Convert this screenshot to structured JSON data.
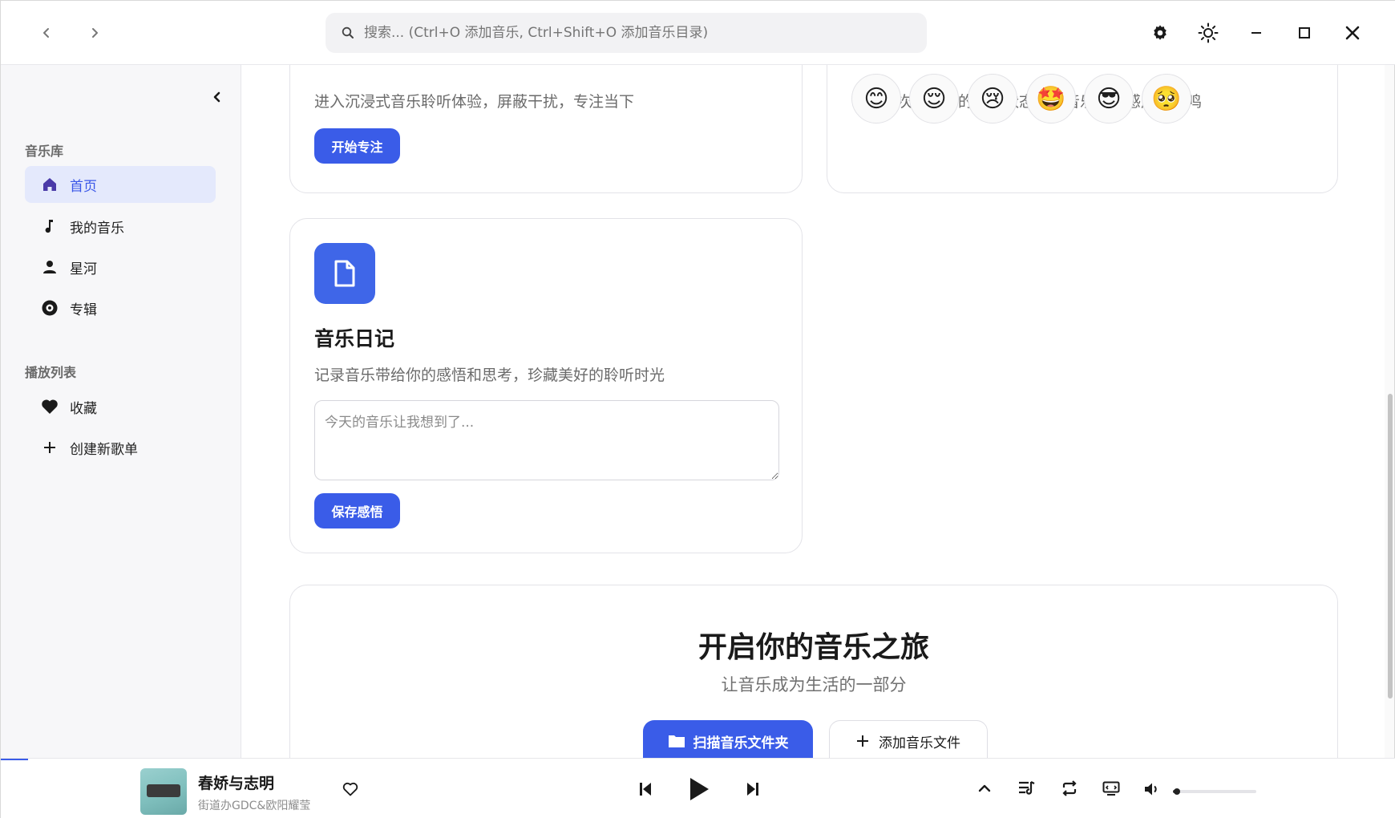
{
  "titlebar": {
    "search_placeholder": "搜索... (Ctrl+O 添加音乐, Ctrl+Shift+O 添加音乐目录)"
  },
  "sidebar": {
    "library_title": "音乐库",
    "library_items": [
      {
        "label": "首页",
        "icon": "home-icon",
        "active": true
      },
      {
        "label": "我的音乐",
        "icon": "music-note-icon",
        "active": false
      },
      {
        "label": "星河",
        "icon": "user-icon",
        "active": false
      },
      {
        "label": "专辑",
        "icon": "disc-icon",
        "active": false
      }
    ],
    "playlist_title": "播放列表",
    "playlist_items": [
      {
        "label": "收藏",
        "icon": "heart-icon"
      },
      {
        "label": "创建新歌单",
        "icon": "plus-icon"
      }
    ]
  },
  "main": {
    "focus_card": {
      "desc": "进入沉浸式音乐聆听体验，屏蔽干扰，专注当下",
      "button": "开始专注"
    },
    "mood_card": {
      "desc": "记录每次聆听时的心情状态，让音乐与情感产生共鸣",
      "emojis": [
        "😊",
        "😌",
        "😢",
        "🤩",
        "😎",
        "🥺"
      ]
    },
    "diary_card": {
      "title": "音乐日记",
      "desc": "记录音乐带给你的感悟和思考，珍藏美好的聆听时光",
      "placeholder": "今天的音乐让我想到了...",
      "button": "保存感悟"
    },
    "journey_card": {
      "title": "开启你的音乐之旅",
      "subtitle": "让音乐成为生活的一部分",
      "scan_button": "扫描音乐文件夹",
      "add_button": "添加音乐文件"
    }
  },
  "player": {
    "title": "春娇与志明",
    "artist": "街道办GDC&欧阳耀莹",
    "volume": 0.05,
    "accent": "#3a5ce8"
  }
}
